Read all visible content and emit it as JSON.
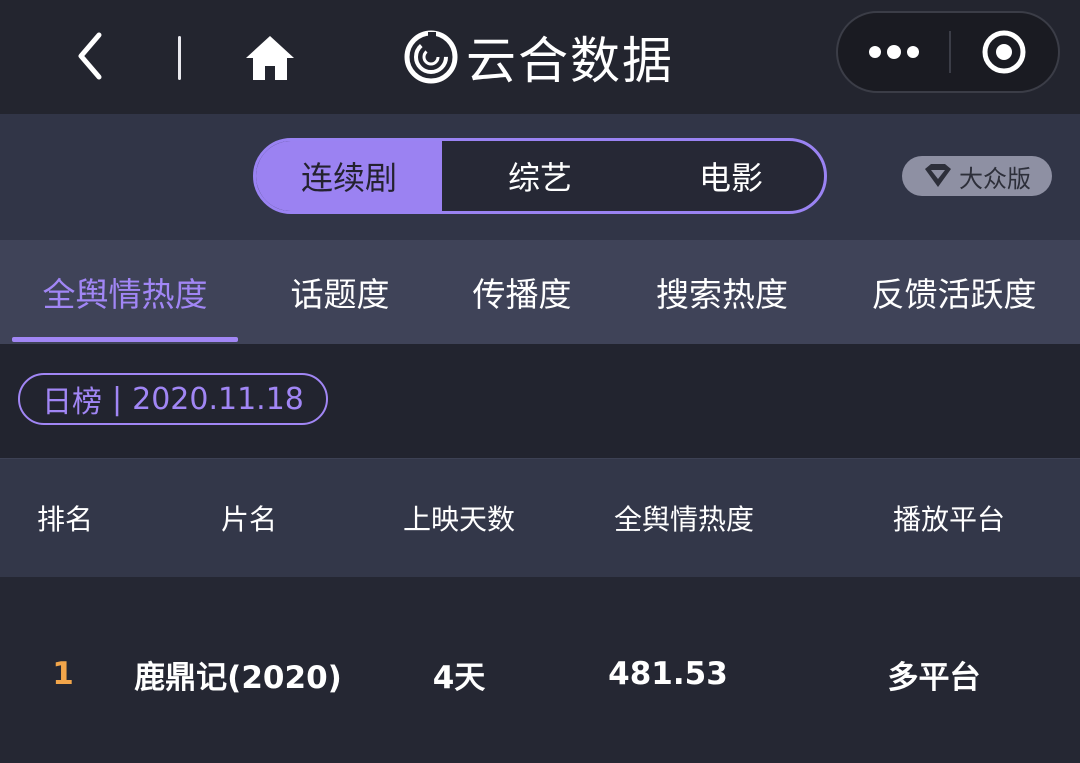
{
  "app": {
    "title": "云合数据",
    "icons": {
      "back": "chevron-left-icon",
      "home": "home-icon",
      "logo": "yunhe-logo-icon",
      "more": "more-dots-icon",
      "close": "target-circle-icon",
      "edition": "diamond-icon"
    }
  },
  "category_tabs": [
    "连续剧",
    "综艺",
    "电影"
  ],
  "selected_category": "连续剧",
  "edition_badge": "大众版",
  "metric_tabs": [
    "全舆情热度",
    "话题度",
    "传播度",
    "搜索热度",
    "反馈活跃度"
  ],
  "selected_metric": "全舆情热度",
  "ranking": {
    "type": "日榜",
    "separator": "|",
    "date": "2020.11.18"
  },
  "table": {
    "headers": [
      "排名",
      "片名",
      "上映天数",
      "全舆情热度",
      "播放平台"
    ],
    "rows": [
      {
        "rank": "1",
        "title": "鹿鼎记(2020)",
        "days": "4天",
        "score": "481.53",
        "platform": "多平台"
      }
    ]
  },
  "colors": {
    "accent": "#a186f5",
    "rank_highlight": "#f2a54a",
    "background": "#22242f"
  }
}
